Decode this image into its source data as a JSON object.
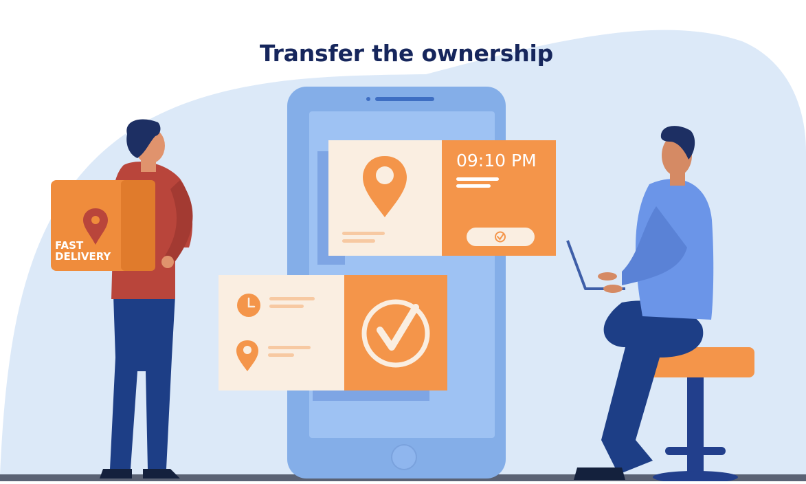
{
  "heading": {
    "title": "Transfer the ownership"
  },
  "delivery_card": {
    "time": "09:10 PM"
  },
  "backpack": {
    "badge_line1": "FAST",
    "badge_line2": "DELIVERY"
  },
  "colors": {
    "background_blob": "#dce9f8",
    "phone_body": "#84aee8",
    "phone_screen": "#9ec2f3",
    "orange": "#f4954a",
    "cream": "#faeee1",
    "navy": "#1d2f63",
    "shirt_blue": "#6b95e8",
    "jacket_red": "#b9453b",
    "title": "#16265c"
  },
  "icons": [
    "location-pin-icon",
    "clock-icon",
    "checkmark-circle-icon",
    "checkmark-button-icon"
  ]
}
